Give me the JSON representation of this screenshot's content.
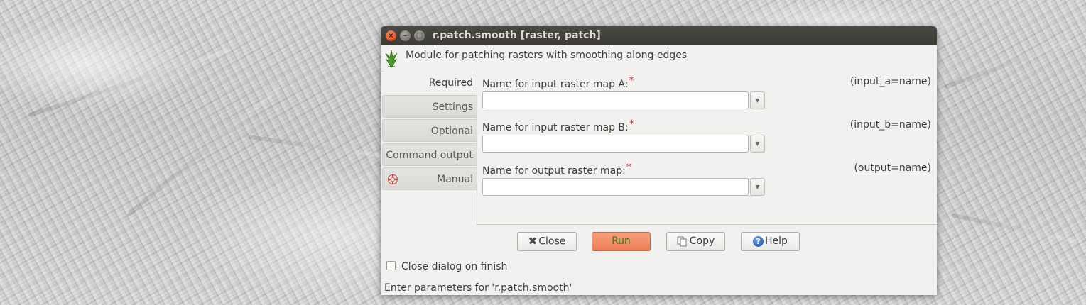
{
  "window": {
    "title": "r.patch.smooth [raster, patch]",
    "description": "Module for patching rasters with smoothing along edges"
  },
  "tabs": [
    {
      "label": "Required",
      "active": true
    },
    {
      "label": "Settings",
      "active": false
    },
    {
      "label": "Optional",
      "active": false
    },
    {
      "label": "Command output",
      "active": false
    },
    {
      "label": "Manual",
      "active": false
    }
  ],
  "params": [
    {
      "label": "Name for input raster map A:",
      "required_mark": "*",
      "key": "(input_a=name)",
      "value": ""
    },
    {
      "label": "Name for input raster map B:",
      "required_mark": "*",
      "key": "(input_b=name)",
      "value": ""
    },
    {
      "label": "Name for output raster map:",
      "required_mark": "*",
      "key": "(output=name)",
      "value": ""
    }
  ],
  "buttons": {
    "close": "Close",
    "run": "Run",
    "copy": "Copy",
    "help": "Help"
  },
  "close_on_finish": {
    "label": "Close dialog on finish",
    "checked": false
  },
  "status": "Enter parameters for 'r.patch.smooth'",
  "icons": {
    "titlebar_close": "close-icon",
    "titlebar_minimize": "minimize-icon",
    "titlebar_maximize": "maximize-icon",
    "module": "grass-logo-icon",
    "manual_tab": "lifebuoy-icon",
    "combo": "chevron-down-icon",
    "close_button": "close-x-icon",
    "copy_button": "copy-icon",
    "help_button": "help-icon"
  },
  "colors": {
    "titlebar": "#3c3b37",
    "window_bg": "#f2f1f0",
    "run_button": "#ee7e55",
    "run_text": "#2f7d12",
    "required_mark": "#d01010"
  }
}
